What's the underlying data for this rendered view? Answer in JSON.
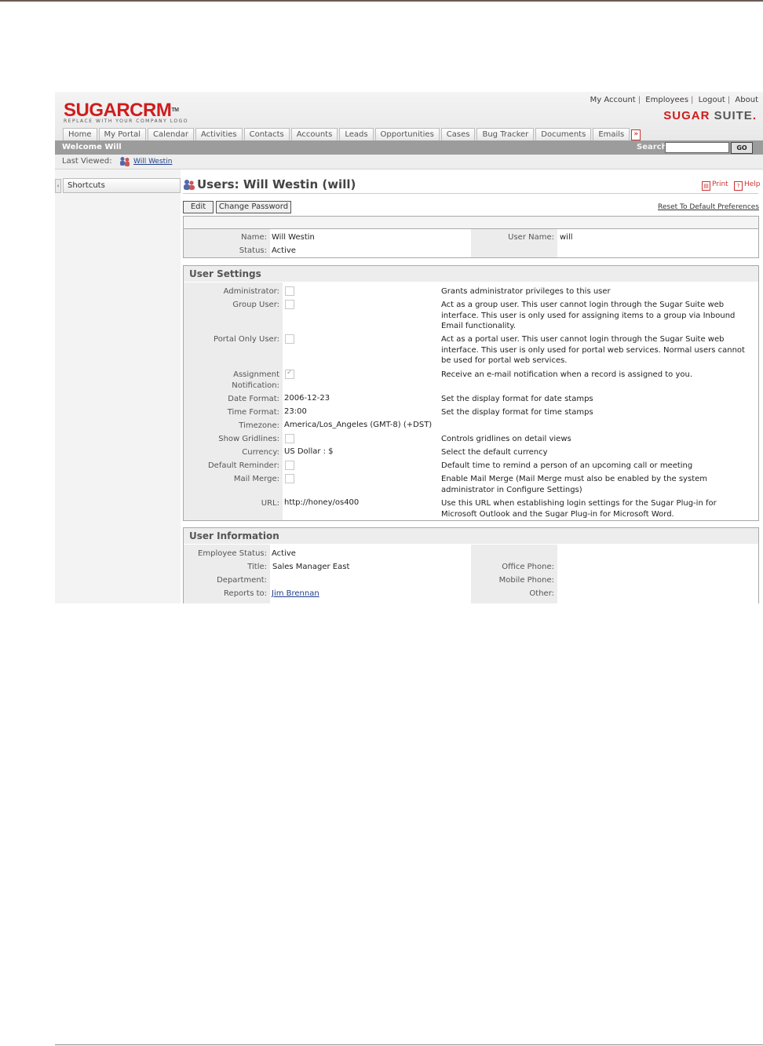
{
  "app": {
    "logo_main": "SUGARCRM",
    "logo_tm": "TM",
    "logo_tagline": "REPLACE WITH YOUR COMPANY LOGO",
    "suite_logo_a": "SUGAR",
    "suite_logo_b": "SUITE",
    "suite_logo_c": "."
  },
  "top_links": [
    "My Account",
    "Employees",
    "Logout",
    "About"
  ],
  "tabs": [
    "Home",
    "My Portal",
    "Calendar",
    "Activities",
    "Contacts",
    "Accounts",
    "Leads",
    "Opportunities",
    "Cases",
    "Bug Tracker",
    "Documents",
    "Emails"
  ],
  "welcome": "Welcome Will",
  "search": {
    "label": "Search",
    "go": "GO"
  },
  "last_viewed": {
    "label": "Last Viewed:",
    "item": "Will Westin"
  },
  "shortcuts": {
    "label": "Shortcuts"
  },
  "page": {
    "title": "Users: Will Westin (will)",
    "print": "Print",
    "help": "Help",
    "edit": "Edit",
    "change_password": "Change Password",
    "reset_prefs": "Reset To Default Preferences"
  },
  "basic": {
    "name_label": "Name:",
    "name": "Will Westin",
    "status_label": "Status:",
    "status": "Active",
    "username_label": "User Name:",
    "username": "will"
  },
  "user_settings": {
    "title": "User Settings",
    "rows": [
      {
        "label": "Administrator:",
        "type": "checkbox",
        "checked": false,
        "desc": "Grants administrator privileges to this user"
      },
      {
        "label": "Group User:",
        "type": "checkbox",
        "checked": false,
        "desc": "Act as a group user. This user cannot login through the Sugar Suite web interface. This user is only used for assigning items to a group via Inbound Email functionality."
      },
      {
        "label": "Portal Only User:",
        "type": "checkbox",
        "checked": false,
        "desc": "Act as a portal user. This user cannot login through the Sugar Suite web interface. This user is only used for portal web services. Normal users cannot be used for portal web services."
      },
      {
        "label": "Assignment Notification:",
        "type": "checkbox",
        "checked": true,
        "desc": "Receive an e-mail notification when a record is assigned to you."
      },
      {
        "label": "Date Format:",
        "type": "text",
        "value": "2006-12-23",
        "desc": "Set the display format for date stamps"
      },
      {
        "label": "Time Format:",
        "type": "text",
        "value": "23:00",
        "desc": "Set the display format for time stamps"
      },
      {
        "label": "Timezone:",
        "type": "text",
        "value": "America/Los_Angeles (GMT-8) (+DST)",
        "desc": ""
      },
      {
        "label": "Show Gridlines:",
        "type": "checkbox",
        "checked": false,
        "desc": "Controls gridlines on detail views"
      },
      {
        "label": "Currency:",
        "type": "text",
        "value": "US Dollar : $",
        "desc": "Select the default currency"
      },
      {
        "label": "Default Reminder:",
        "type": "checkbox",
        "checked": false,
        "desc": "Default time to remind a person of an upcoming call or meeting"
      },
      {
        "label": "Mail Merge:",
        "type": "checkbox",
        "checked": false,
        "desc": "Enable Mail Merge (Mail Merge must also be enabled by the system administrator in Configure Settings)"
      },
      {
        "label": "URL:",
        "type": "text",
        "value": "http://honey/os400",
        "desc": "Use this URL when establishing login settings for the Sugar Plug-in for Microsoft Outlook and the Sugar Plug-in for Microsoft Word."
      }
    ]
  },
  "user_info": {
    "title": "User Information",
    "left": [
      {
        "label": "Employee Status:",
        "value": "Active"
      },
      {
        "label": "Title:",
        "value": "Sales Manager East"
      },
      {
        "label": "Department:",
        "value": ""
      },
      {
        "label": "Reports to:",
        "value": "Jim Brennan",
        "link": true
      }
    ],
    "right": [
      {
        "label": "Office Phone:",
        "value": ""
      },
      {
        "label": "Mobile Phone:",
        "value": ""
      },
      {
        "label": "Other:",
        "value": ""
      }
    ]
  },
  "colors": {
    "brand_red": "#cf1d1d",
    "bar_gray": "#9c9c9c",
    "link_blue": "#1f3d8a"
  }
}
